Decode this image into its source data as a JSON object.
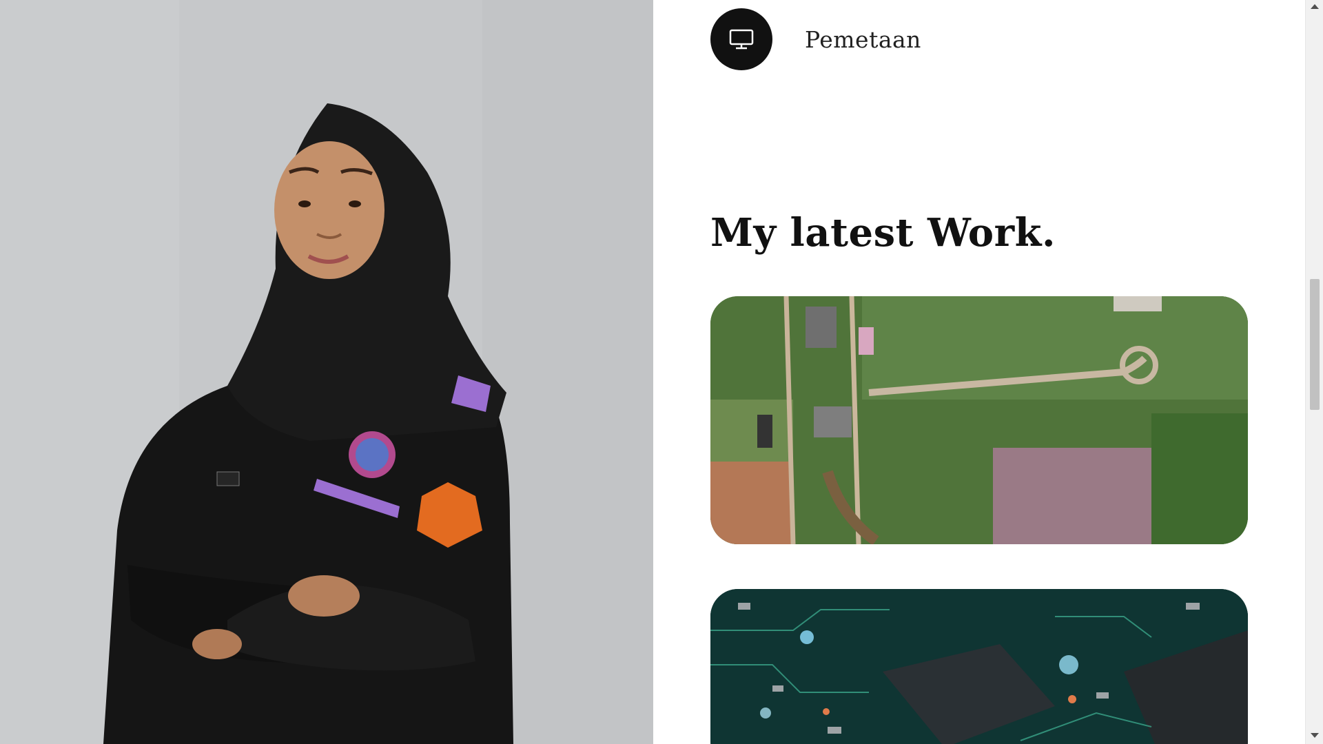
{
  "services": {
    "item": {
      "icon": "monitor-icon",
      "label": "Pemetaan"
    }
  },
  "portfolio": {
    "title": "My latest Work.",
    "items": [
      {
        "image": "aerial-map-photo"
      },
      {
        "image": "circuit-board-photo"
      }
    ]
  },
  "colors": {
    "icon_bg": "#111111",
    "accent_purple": "#9b6fd1",
    "uniform": "#151515"
  }
}
